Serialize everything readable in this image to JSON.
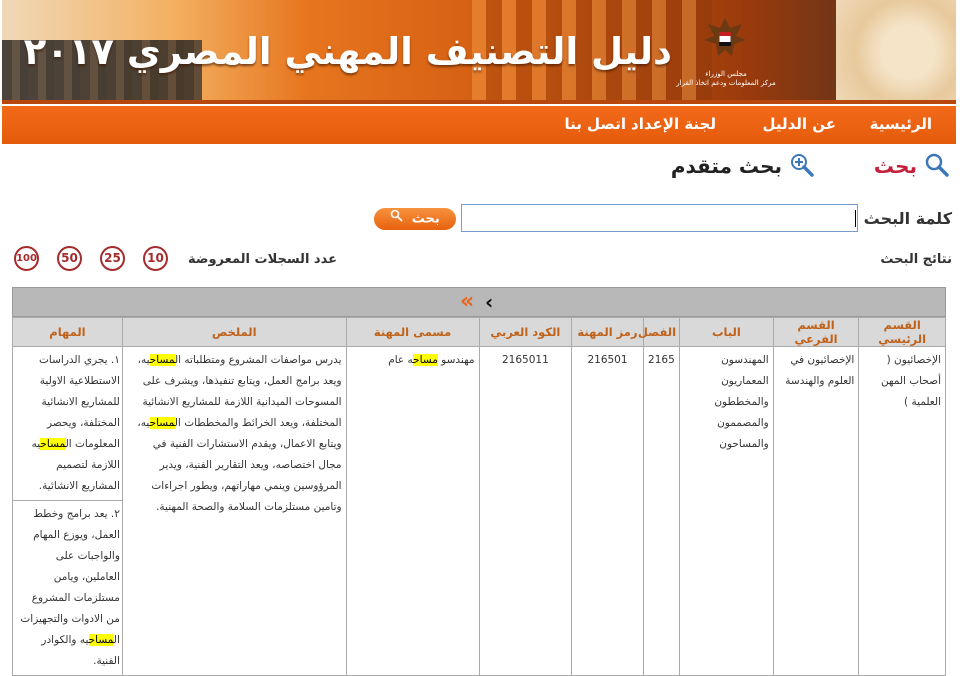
{
  "header": {
    "site_title": "دليل التصنيف المهني المصري ٢٠١٧",
    "ministry_line1": "مجلس الوزراء",
    "ministry_line2": "مركز المعلومات ودعم اتخاذ القرار"
  },
  "nav": {
    "home": "الرئيسية",
    "about": "عن الدليل",
    "committee": "لجنة الإعداد",
    "contact": "اتصل بنا"
  },
  "search": {
    "simple_label": "بحث",
    "advanced_label": "بحث متقدم",
    "keyword_label": "كلمة البحث",
    "keyword_value": "",
    "button_label": "بحث",
    "results_label": "نتائج البحث",
    "records_label": "عدد السجلات المعروضة",
    "counts": [
      "10",
      "25",
      "50",
      "100"
    ]
  },
  "colors": {
    "accent": "#e8661b",
    "count_ring": "#a52c2c",
    "header_text": "#c0621a",
    "highlight": "#ffff00"
  },
  "table": {
    "headers": [
      "القسم الرئيسي",
      "القسم الفرعي",
      "الباب",
      "الفصل",
      "رمز المهنة",
      "الكود العربي",
      "مسمى المهنة",
      "الملخص",
      "المهام"
    ],
    "row": {
      "main_section": "الإخصائيون ( أصحاب المهن العلمية )",
      "sub_section": "الإخصائيون في العلوم والهندسة",
      "chapter": "المهندسون المعماريون والمخططون والمصممون والمساحون",
      "section": "2165",
      "job_code": "216501",
      "arab_code": "2165011",
      "title_pre": "مهندسو ",
      "title_mark": "مساح",
      "title_post": "ه عام",
      "summary": {
        "p1": "يدرس مواصفات المشروع ومتطلباته ال",
        "m1": "مساح",
        "p2": "يه، ويعد برامج العمل، ويتابع تنفيذها، ويشرف على المسوحات الميدانية اللازمة للمشاريع الانشائية المختلفة، ويعد الخرائط والمخططات ال",
        "m2": "مساح",
        "p3": "يه، ويتابع الاعمال، ويقدم الاستشارات الفنية في مجال اختصاصه، ويعد التقارير الفنية، ويدير المرؤوسين وينمي مهاراتهم، ويطور اجراءات وتامين مستلزمات السلامة والصحة المهنية."
      },
      "task1": {
        "p1": "١. يجري الدراسات الاستطلاعية الاولية للمشاريع الانشائية المختلفة، ويحصر المعلومات ال",
        "m1": "مساح",
        "p2": "يه اللازمة لتصميم المشاريع الانشائية."
      },
      "task2": {
        "p1": "٢. يعد برامج وخطط العمل، ويوزع المهام والواجبات على العاملين، ويامن مستلزمات المشروع من الادوات والتجهيزات ال",
        "m1": "مساح",
        "p2": "يه والكوادر الفنية."
      }
    }
  }
}
